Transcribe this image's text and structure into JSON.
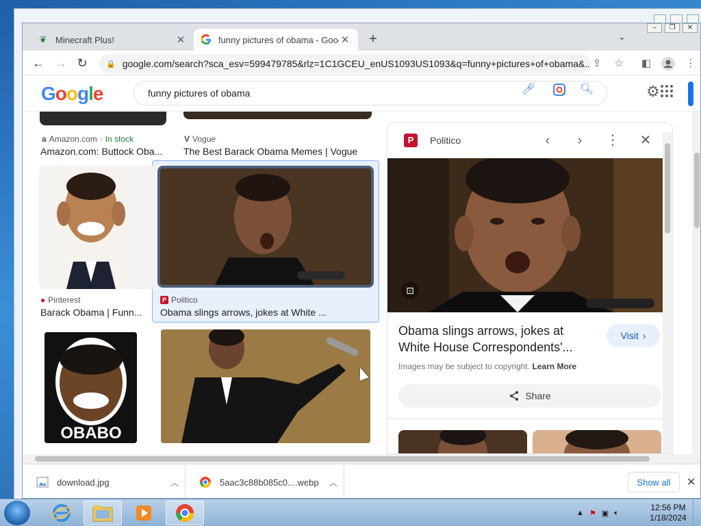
{
  "browser": {
    "tabs": [
      {
        "title": "Minecraft Plus!",
        "close": "✕"
      },
      {
        "title": "funny pictures of obama - Googl",
        "close": "✕"
      }
    ],
    "new_tab": "+",
    "url": "google.com/search?sca_esv=599479785&rlz=1C1GCEU_enUS1093US1093&q=funny+pictures+of+obama&..."
  },
  "google": {
    "logo": "Google",
    "query": "funny pictures of obama"
  },
  "results": [
    {
      "source": "Amazon.com",
      "extra": "In stock",
      "caption": "Amazon.com: Buttock Oba..."
    },
    {
      "source": "Vogue",
      "caption": "The Best Barack Obama Memes | Vogue"
    },
    {
      "source": "Pinterest",
      "caption": "Barack Obama | Funn..."
    },
    {
      "source": "Politico",
      "caption": "Obama slings arrows, jokes at White ..."
    },
    {
      "poster_text": "OBABO"
    }
  ],
  "panel": {
    "source": "Politico",
    "title": "Obama slings arrows, jokes at White House Correspondents'...",
    "visit": "Visit",
    "copyright": "Images may be subject to copyright.",
    "learn_more": "Learn More",
    "share": "Share"
  },
  "downloads": {
    "items": [
      "download.jpg",
      "5aac3c88b085c0....webp"
    ],
    "show_all": "Show all"
  },
  "taskbar": {
    "time": "12:56 PM",
    "date": "1/18/2024"
  },
  "colors": {
    "accent": "#1a73e8",
    "politico": "#c4132e",
    "selected_bg": "#e8f0fe"
  }
}
